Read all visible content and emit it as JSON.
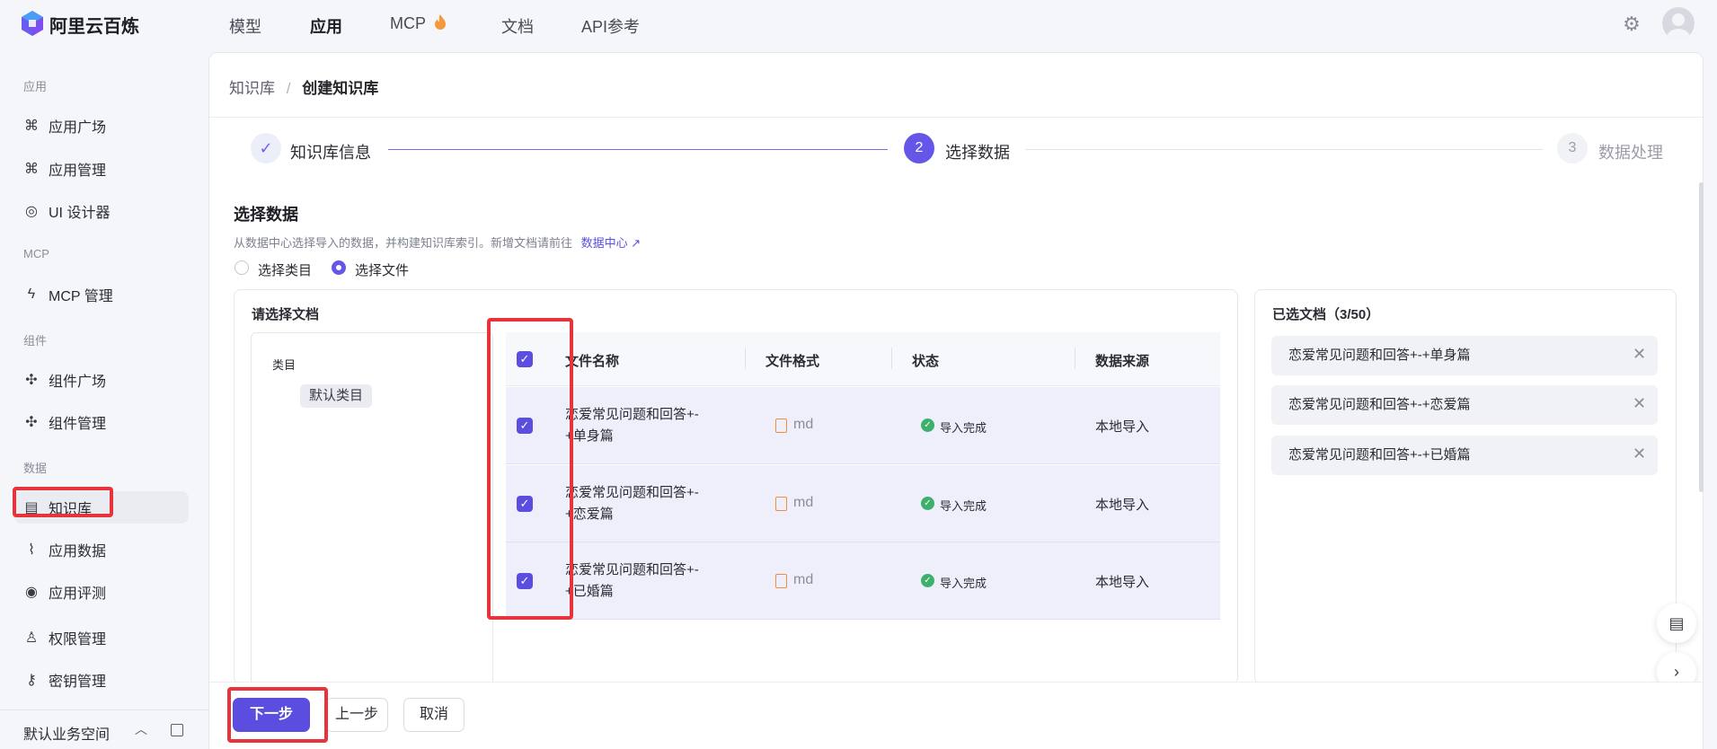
{
  "app": {
    "name": "阿里云百炼"
  },
  "topnav": [
    "模型",
    "应用",
    "MCP",
    "文档",
    "API参考"
  ],
  "sidebar": {
    "groups": [
      "应用",
      "MCP",
      "组件",
      "数据"
    ],
    "items": [
      "应用广场",
      "应用管理",
      "UI 设计器",
      "MCP 管理",
      "组件广场",
      "组件管理",
      "知识库",
      "应用数据",
      "应用评测",
      "权限管理",
      "密钥管理"
    ],
    "workspace": "默认业务空间"
  },
  "breadcrumb": {
    "parent": "知识库",
    "separator": "/",
    "current": "创建知识库"
  },
  "steps": [
    {
      "label": "知识库信息",
      "state": "done"
    },
    {
      "number": "2",
      "label": "选择数据",
      "state": "active"
    },
    {
      "number": "3",
      "label": "数据处理",
      "state": "todo"
    }
  ],
  "section": {
    "title": "选择数据",
    "desc": "从数据中心选择导入的数据，并构建知识库索引。新增文档请前往",
    "link": "数据中心",
    "radios": [
      "选择类目",
      "选择文件"
    ],
    "selected_radio": "选择文件"
  },
  "doc_panel": {
    "title": "请选择文档",
    "tree_head": "类目",
    "category": "默认类目",
    "columns": [
      "文件名称",
      "文件格式",
      "状态",
      "数据来源"
    ],
    "rows": [
      {
        "name_line1": "恋爱常见问题和回答+-",
        "name_line2": "+单身篇",
        "format": "md",
        "status": "导入完成",
        "source": "本地导入"
      },
      {
        "name_line1": "恋爱常见问题和回答+-",
        "name_line2": "+恋爱篇",
        "format": "md",
        "status": "导入完成",
        "source": "本地导入"
      },
      {
        "name_line1": "恋爱常见问题和回答+-",
        "name_line2": "+已婚篇",
        "format": "md",
        "status": "导入完成",
        "source": "本地导入"
      }
    ]
  },
  "selected_panel": {
    "title": "已选文档（3/50）",
    "items": [
      "恋爱常见问题和回答+-+单身篇",
      "恋爱常见问题和回答+-+恋爱篇",
      "恋爱常见问题和回答+-+已婚篇"
    ]
  },
  "footer": {
    "next": "下一步",
    "prev": "上一步",
    "cancel": "取消"
  },
  "colors": {
    "accent": "#5b4de0",
    "highlight": "#e8333a",
    "success": "#3db16c"
  }
}
